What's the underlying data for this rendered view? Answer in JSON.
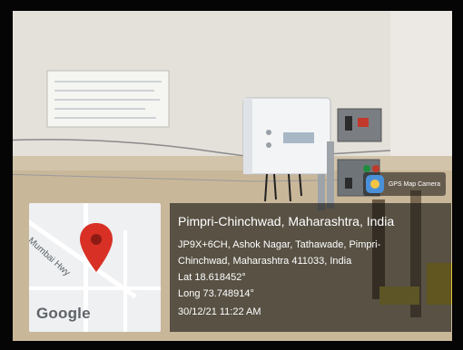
{
  "app_badge": {
    "icon": "gps-map-camera-icon",
    "label": "GPS Map Camera"
  },
  "map": {
    "road_label": "Mumbai Hwy",
    "logo_text": "Google",
    "pin_color": "#d93025"
  },
  "location": {
    "title": "Pimpri-Chinchwad, Maharashtra, India",
    "address_line1": "JP9X+6CH, Ashok Nagar, Tathawade, Pimpri-",
    "address_line2": "Chinchwad, Maharashtra 411033, India",
    "lat": "Lat 18.618452°",
    "long": "Long 73.748914°",
    "datetime": "30/12/21 11:22 AM"
  }
}
